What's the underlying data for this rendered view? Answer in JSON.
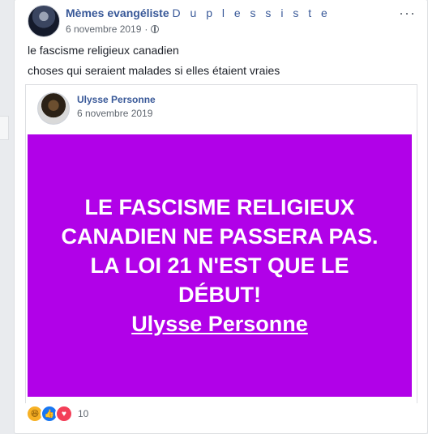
{
  "post": {
    "author_bold": "Mèmes evangéliste",
    "author_spaced": "D u p l e s s i s t e",
    "date": "6 novembre 2019",
    "separator": "·",
    "more_label": "···",
    "line1": "le fascisme religieux canadien",
    "line2": "choses qui seraient malades si elles étaient vraies"
  },
  "shared": {
    "author": "Ulysse Personne",
    "date": "6 novembre 2019",
    "image_text": "LE FASCISME RELIGIEUX CANADIEN NE PASSERA PAS. LA LOI 21 N'EST QUE LE DÉBUT!",
    "image_link": "Ulysse Personne",
    "bg_color": "#b101e8"
  },
  "reactions": {
    "icons": [
      "haha-icon",
      "like-icon",
      "love-icon"
    ],
    "count": "10"
  }
}
